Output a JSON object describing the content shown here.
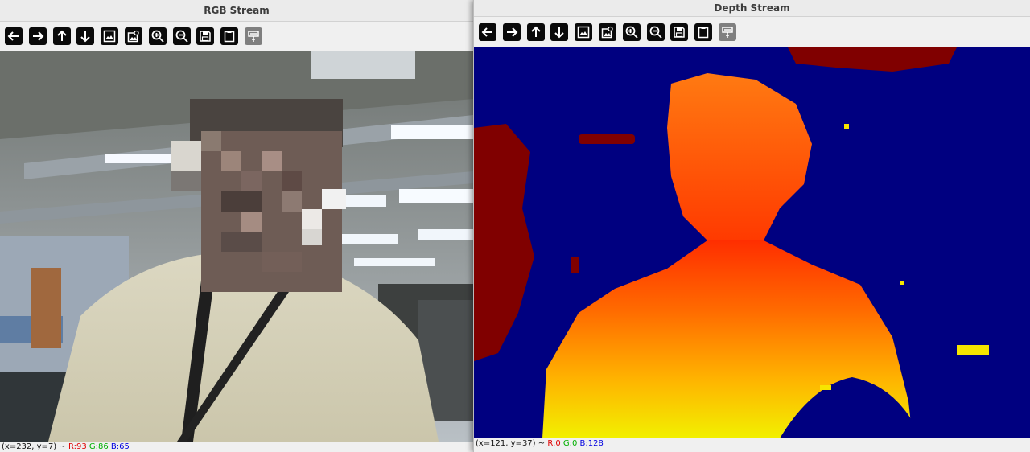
{
  "rgb_window": {
    "title": "RGB Stream",
    "status": {
      "coords": "(x=232, y=7) ~",
      "r": "R:93",
      "g": "G:86",
      "b": "B:65"
    }
  },
  "depth_window": {
    "title": "Depth Stream",
    "status": {
      "coords": "(x=121, y=37) ~",
      "r": "R:0",
      "g": "G:0",
      "b": "B:128"
    }
  },
  "toolbar_icons": [
    "arrow-left-icon",
    "arrow-right-icon",
    "arrow-up-icon",
    "arrow-down-icon",
    "image-icon",
    "image-zoom-icon",
    "zoom-in-icon",
    "zoom-out-icon",
    "save-icon",
    "clipboard-icon",
    "properties-icon"
  ],
  "colors": {
    "depth_background": "#000080",
    "status_r": "#e00000",
    "status_g": "#00b000",
    "status_b": "#0000e0"
  }
}
